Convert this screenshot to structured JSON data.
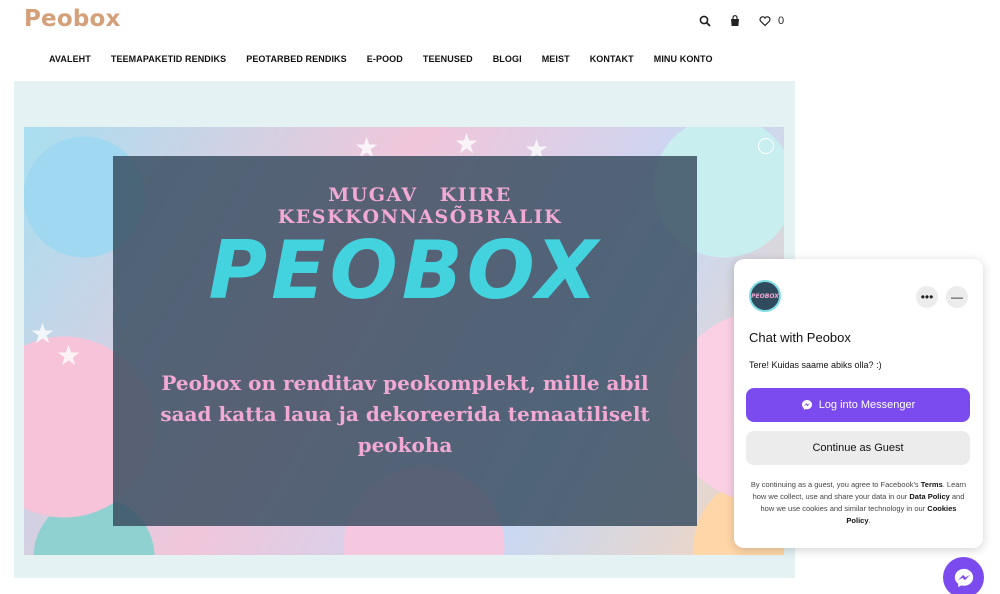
{
  "site": {
    "logo": "Peobox",
    "wishlist_count": "0",
    "icons": [
      "search-icon",
      "cart-icon",
      "heart-icon"
    ]
  },
  "nav": {
    "items": [
      "AVALEHT",
      "TEEMAPAKETID RENDIKS",
      "PEOTARBED RENDIKS",
      "E-POOD",
      "TEENUSED",
      "BLOGI",
      "MEIST",
      "KONTAKT",
      "MINU KONTO"
    ]
  },
  "hero": {
    "tagline": "MUGAV KIIRE KESKKONNASÕBRALIK",
    "title": "PEOBOX",
    "description": "Peobox on renditav peokomplekt, mille abil saad katta laua ja dekoreerida temaatiliselt peokoha"
  },
  "chat": {
    "avatar_text": "PEOBOX",
    "title": "Chat with Peobox",
    "greeting": "Tere! Kuidas saame abiks olla? :)",
    "login_label": "Log into Messenger",
    "guest_label": "Continue as Guest",
    "legal": {
      "part1": "By continuing as a guest, you agree to Facebook's",
      "terms": "Terms",
      "part2": ". Learn how we collect, use and share your data in our",
      "data_policy": "Data Policy",
      "part3": "and how we use cookies and similar technology in our",
      "cookies_policy": "Cookies Policy",
      "part4": "."
    }
  },
  "colors": {
    "logo": "#d4a07a",
    "hero_bg": "#e4f2f4",
    "overlay": "#394e60",
    "pink_text": "#f2a9d4",
    "title_cyan": "#43d3df",
    "messenger": "#7b4bf0"
  }
}
